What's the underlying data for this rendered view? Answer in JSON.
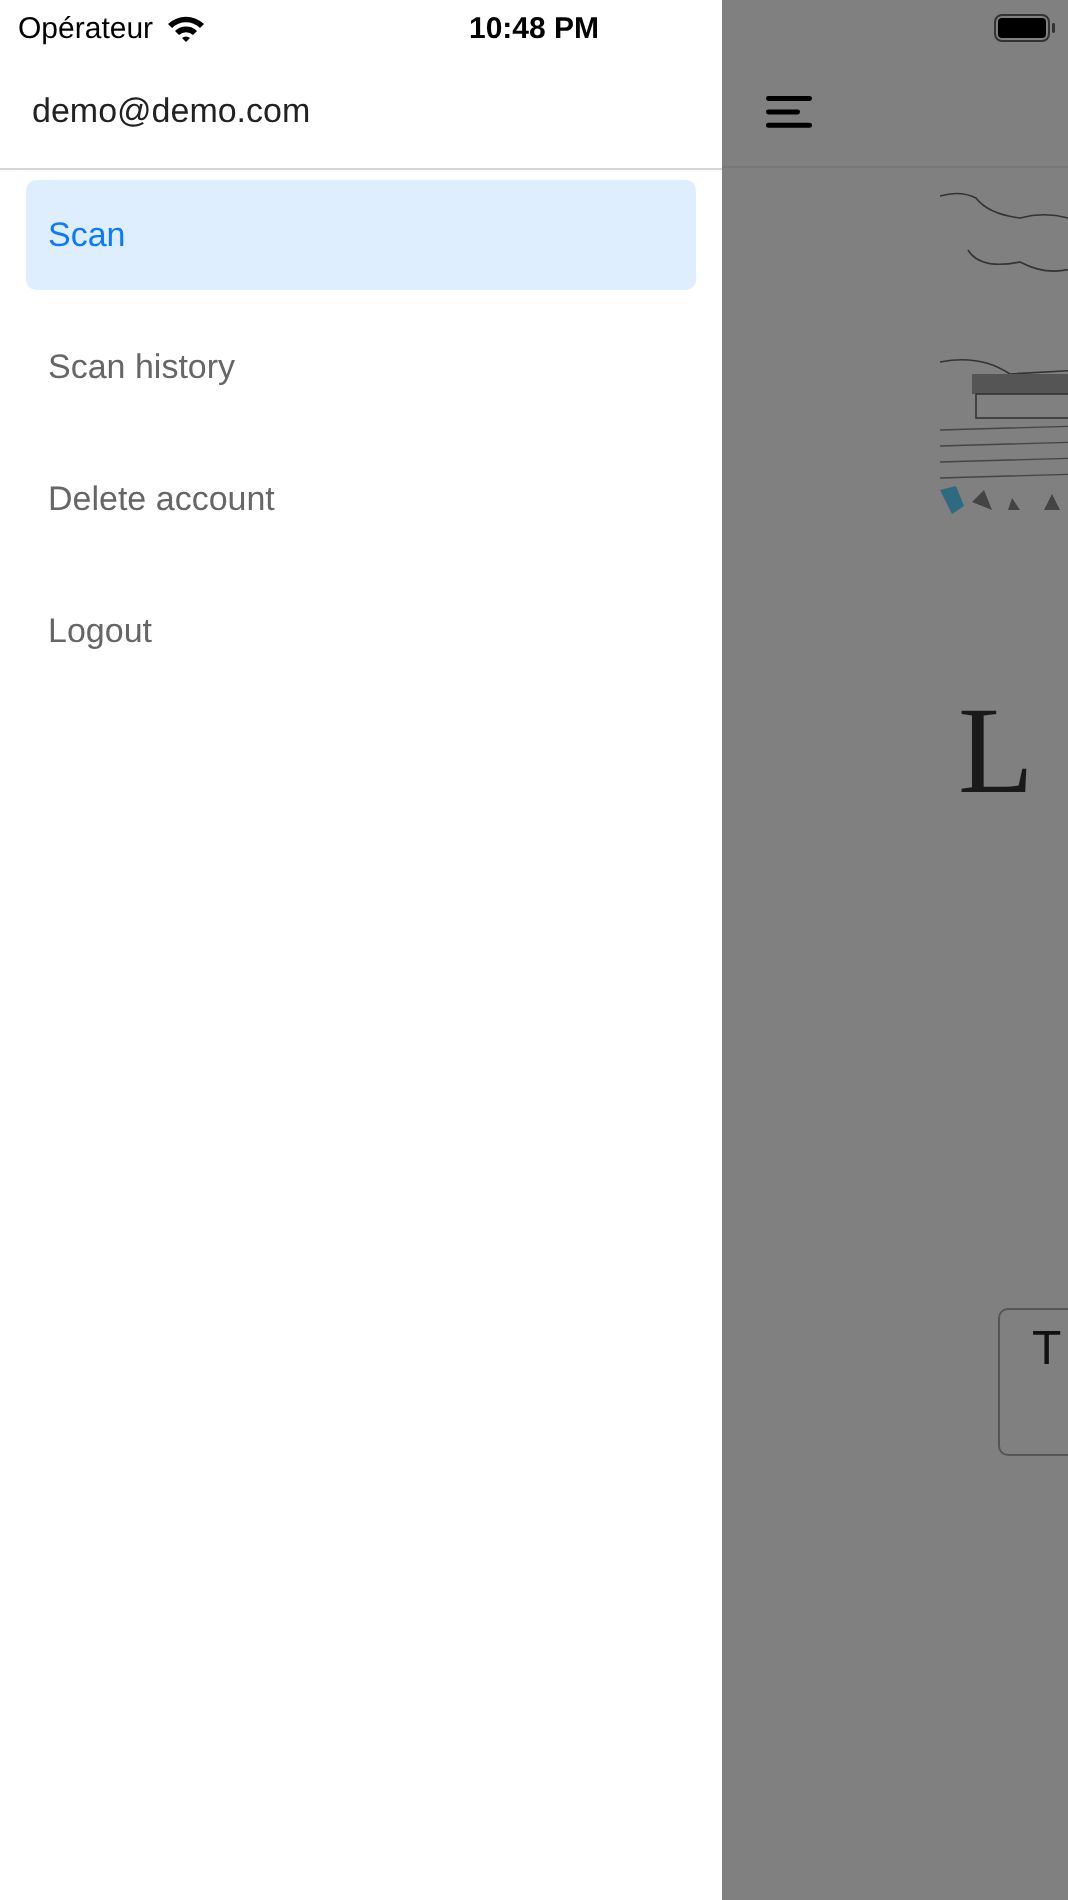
{
  "status_bar": {
    "carrier": "Opérateur",
    "time": "10:48 PM"
  },
  "drawer": {
    "account": "demo@demo.com",
    "items": [
      {
        "label": "Scan",
        "selected": true
      },
      {
        "label": "Scan history",
        "selected": false
      },
      {
        "label": "Delete account",
        "selected": false
      },
      {
        "label": "Logout",
        "selected": false
      }
    ]
  },
  "background_page": {
    "heading": "L",
    "field_text": "T"
  }
}
